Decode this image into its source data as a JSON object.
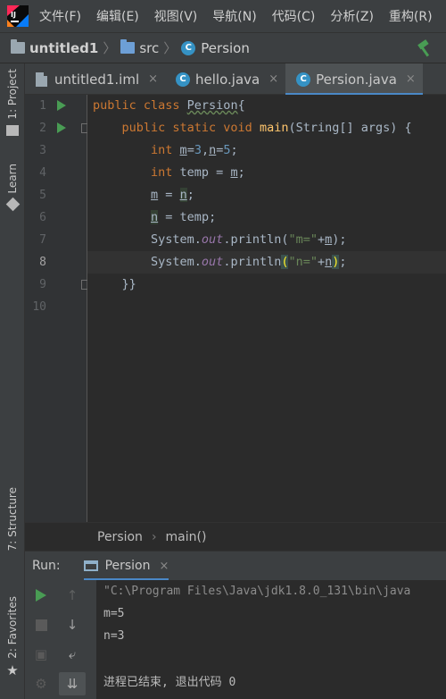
{
  "menu": {
    "items": [
      "文件(F)",
      "编辑(E)",
      "视图(V)",
      "导航(N)",
      "代码(C)",
      "分析(Z)",
      "重构(R)"
    ]
  },
  "navbar": {
    "project": "untitled1",
    "folder": "src",
    "file": "Persion",
    "class_icon_letter": "C"
  },
  "tool_stripe": {
    "project": "1: Project",
    "learn": "Learn",
    "structure": "7: Structure",
    "favorites": "2: Favorites"
  },
  "tabs": [
    {
      "label": "untitled1.iml",
      "active": false
    },
    {
      "label": "hello.java",
      "active": false
    },
    {
      "label": "Persion.java",
      "active": true
    }
  ],
  "tab_close_glyph": "×",
  "editor": {
    "line_numbers": [
      "1",
      "2",
      "3",
      "4",
      "5",
      "6",
      "7",
      "8",
      "9",
      "10"
    ],
    "current_line": "8"
  },
  "editor_breadcrumb": {
    "class": "Persion",
    "method": "main()"
  },
  "run_panel": {
    "label": "Run:",
    "tab": "Persion",
    "console": [
      "\"C:\\Program Files\\Java\\jdk1.8.0_131\\bin\\java",
      "m=5",
      "n=3",
      "",
      "进程已结束, 退出代码 0"
    ]
  },
  "colors": {
    "keyword": "#cc7832",
    "method": "#ffc66d",
    "number": "#6897bb",
    "string": "#6a8759",
    "field": "#9876aa",
    "accent": "#4a88c7",
    "run": "#499c54"
  }
}
